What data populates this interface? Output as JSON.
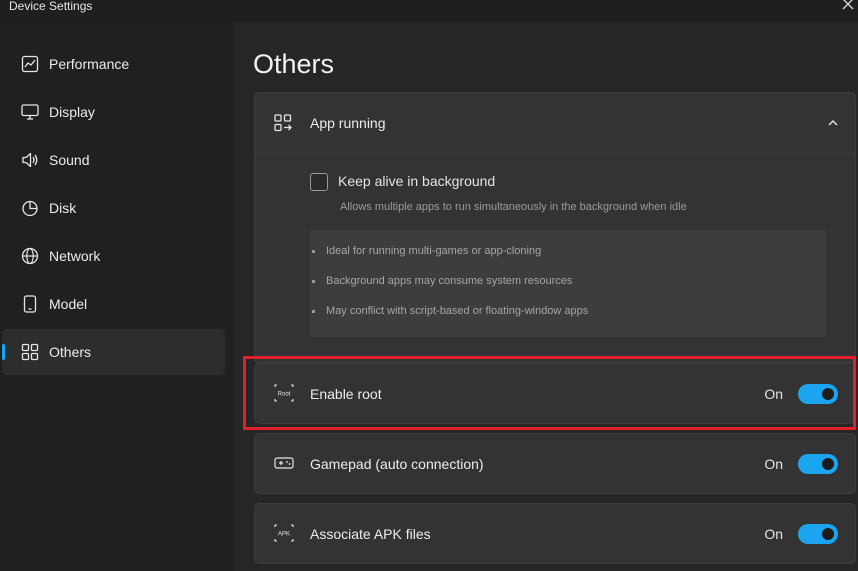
{
  "window": {
    "title": "Device Settings",
    "close_icon": "close-icon"
  },
  "sidebar": {
    "items": [
      {
        "label": "Performance",
        "icon": "performance-chart-icon",
        "active": false
      },
      {
        "label": "Display",
        "icon": "monitor-icon",
        "active": false
      },
      {
        "label": "Sound",
        "icon": "speaker-icon",
        "active": false
      },
      {
        "label": "Disk",
        "icon": "pie-chart-icon",
        "active": false
      },
      {
        "label": "Network",
        "icon": "globe-icon",
        "active": false
      },
      {
        "label": "Model",
        "icon": "phone-icon",
        "active": false
      },
      {
        "label": "Others",
        "icon": "grid-icon",
        "active": true
      }
    ]
  },
  "main": {
    "title": "Others",
    "app_running": {
      "label": "App running",
      "expanded": true,
      "keep_alive": {
        "label": "Keep alive in background",
        "checked": false,
        "description": "Allows multiple apps to run simultaneously in the background when idle"
      },
      "notes": [
        "Ideal for running multi-games or app-cloning",
        "Background apps may consume system resources",
        "May conflict with script-based or floating-window apps"
      ]
    },
    "enable_root": {
      "label": "Enable root",
      "icon_text": "Root",
      "state": "On",
      "enabled": true
    },
    "gamepad": {
      "label": "Gamepad (auto connection)",
      "state": "On",
      "enabled": true
    },
    "apk": {
      "label": "Associate APK files",
      "icon_text": "APK",
      "state": "On",
      "enabled": true
    }
  },
  "colors": {
    "accent": "#1ba4f0",
    "highlight": "#e0202b",
    "background": "#262626",
    "card": "#333333"
  }
}
